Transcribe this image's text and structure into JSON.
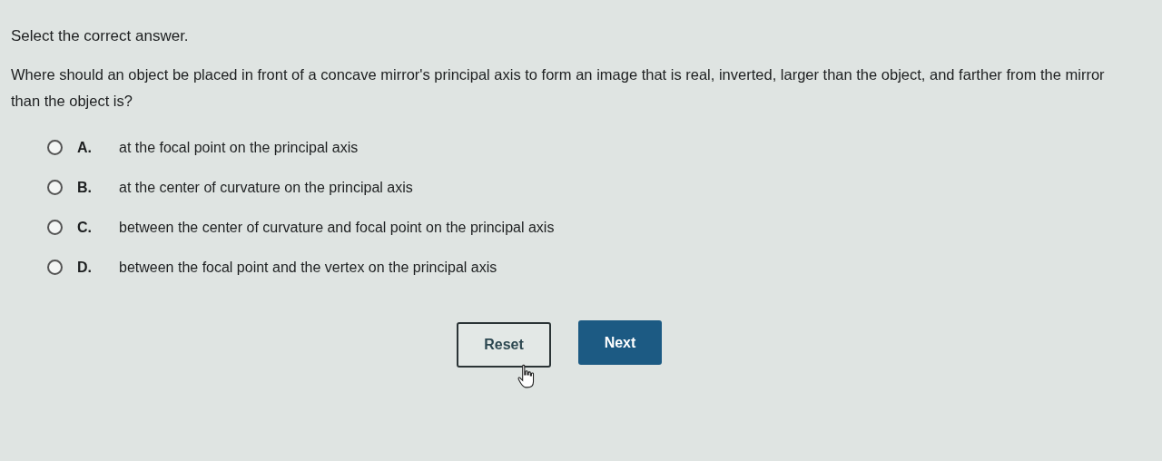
{
  "instruction": "Select the correct answer.",
  "question": "Where should an object be placed in front of a concave mirror's principal axis to form an image that is real, inverted, larger than the object, and farther from the mirror than the object is?",
  "options": [
    {
      "letter": "A.",
      "text": "at the focal point on the principal axis",
      "selected": false
    },
    {
      "letter": "B.",
      "text": "at the center of curvature on the principal axis",
      "selected": false
    },
    {
      "letter": "C.",
      "text": "between the center of curvature and focal point on the principal axis",
      "selected": false
    },
    {
      "letter": "D.",
      "text": "between the focal point and the vertex on the principal axis",
      "selected": false
    }
  ],
  "buttons": [
    {
      "label": "Reset",
      "kind": "outline"
    },
    {
      "label": "Next",
      "kind": "primary"
    }
  ]
}
